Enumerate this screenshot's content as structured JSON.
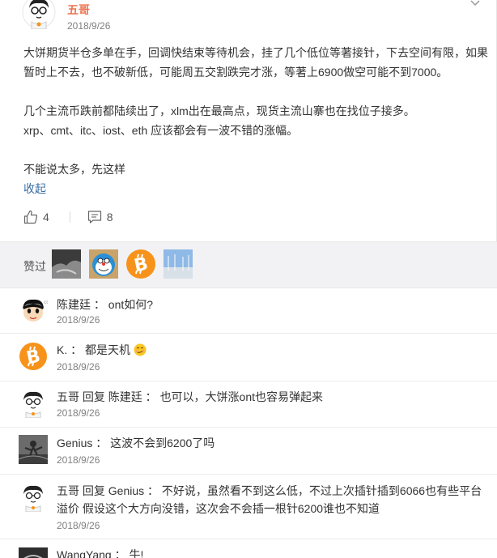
{
  "post": {
    "author": "五哥",
    "date": "2018/9/26",
    "paragraphs": [
      "大饼期货半仓多单在手，回调快结束等待机会，挂了几个低位等著接针，下去空间有限，如果暂时上不去，也不破新低，可能周五交割跌完才涨，等著上6900做空可能不到7000。",
      "",
      "几个主流币跌前都陆续出了，xlm出在最高点，现货主流山寨也在找位子接多。",
      "xrp、cmt、itc、iost、eth 应该都会有一波不错的涨幅。",
      "",
      "不能说太多，先这样"
    ],
    "collapse_label": "收起",
    "like_count": "4",
    "comment_count": "8"
  },
  "likes": {
    "label": "赞过"
  },
  "comments": [
    {
      "user": "陈建廷",
      "reply_label": "",
      "reply_to": "",
      "sep": "：",
      "text": "ont如何?",
      "date": "2018/9/26"
    },
    {
      "user": "K.",
      "reply_label": "",
      "reply_to": "",
      "sep": "：",
      "text": "都是天机",
      "date": "2018/9/26"
    },
    {
      "user": "五哥",
      "reply_label": "回复",
      "reply_to": "陈建廷",
      "sep": "：",
      "text": "也可以，大饼涨ont也容易弹起来",
      "date": "2018/9/26"
    },
    {
      "user": "Genius",
      "reply_label": "",
      "reply_to": "",
      "sep": "：",
      "text": "这波不会到6200了吗",
      "date": "2018/9/26"
    },
    {
      "user": "五哥",
      "reply_label": "回复",
      "reply_to": "Genius",
      "sep": "：",
      "text": "不好说，虽然看不到这么低，不过上次插针插到6066也有些平台溢价 假设这个大方向没错，这次会不会插一根针6200谁也不知道",
      "date": "2018/9/26"
    },
    {
      "user": "WangYang",
      "reply_label": "",
      "reply_to": "",
      "sep": "：",
      "text": "牛!",
      "date": ""
    }
  ],
  "colors": {
    "author_name": "#eb7350",
    "link": "#3a6ea5",
    "bitcoin": "#f7931a"
  },
  "icons": {
    "like": "thumbs-up-icon",
    "comment": "comment-icon",
    "more": "chevron-down-icon",
    "bitcoin": "bitcoin-icon",
    "emoji": "smirk-emoji-icon"
  }
}
